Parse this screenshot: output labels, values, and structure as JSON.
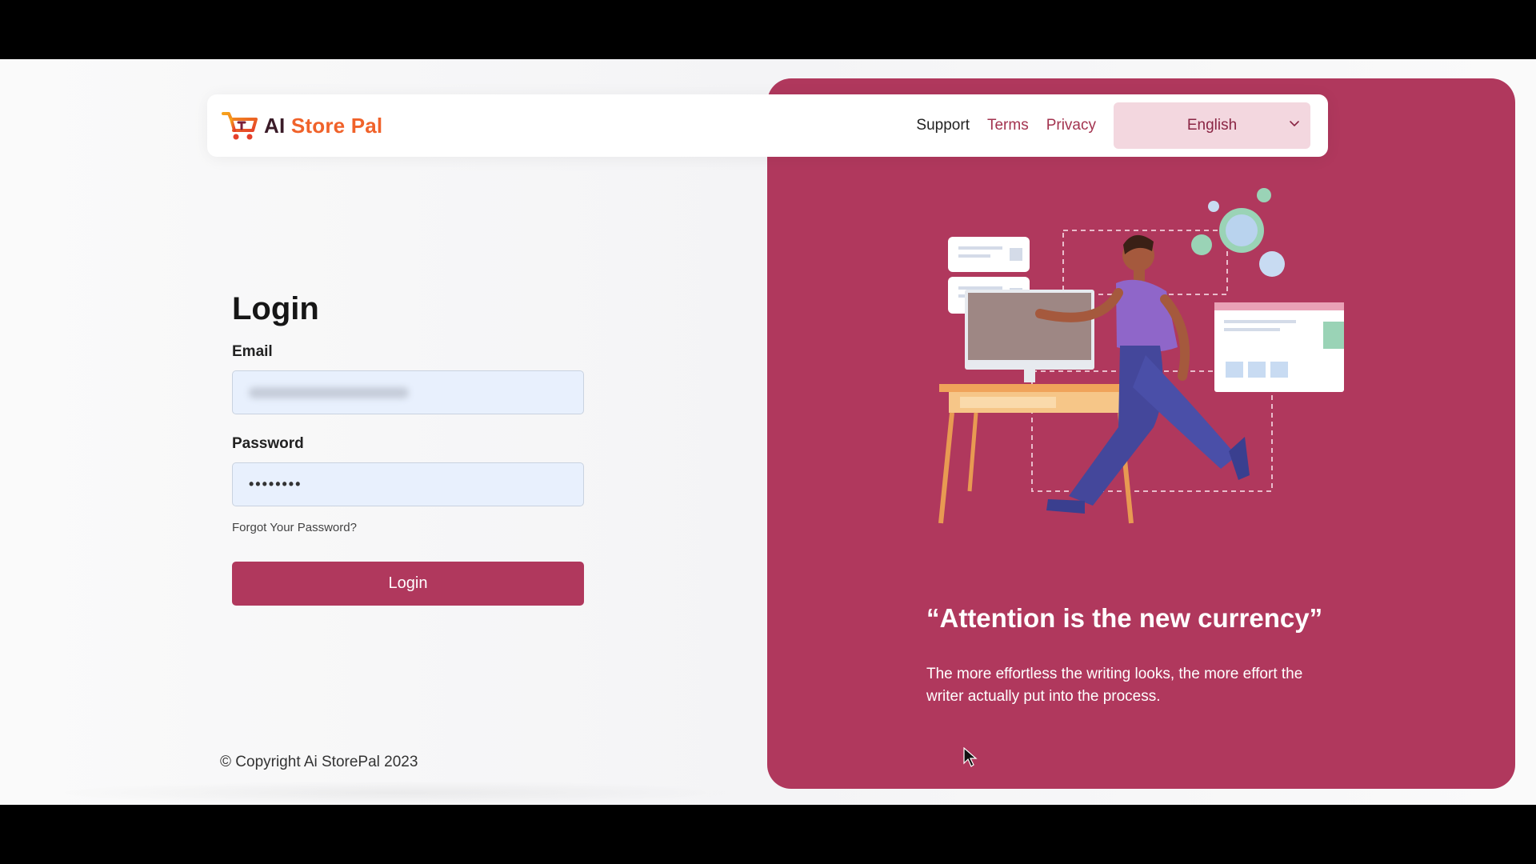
{
  "brand": {
    "logo_ai": "AI",
    "logo_store_pal": "Store Pal",
    "logo_icon": "shopping-cart-icon",
    "colors": {
      "primary": "#b0385d",
      "accent_orange": "#f0622a",
      "input_bg": "#e8f0fd"
    }
  },
  "nav": {
    "support": "Support",
    "terms": "Terms",
    "privacy": "Privacy",
    "language": "English",
    "language_icon": "chevron-down-icon"
  },
  "login": {
    "title": "Login",
    "email_label": "Email",
    "email_value": "",
    "password_label": "Password",
    "password_value": "••••••••",
    "forgot_link": "Forgot Your Password?",
    "submit_label": "Login"
  },
  "footer": {
    "copyright": "© Copyright Ai StorePal 2023"
  },
  "hero": {
    "quote": "“Attention is the new currency”",
    "body": "The more effortless the writing looks, the more effort the writer actually put into the process."
  }
}
